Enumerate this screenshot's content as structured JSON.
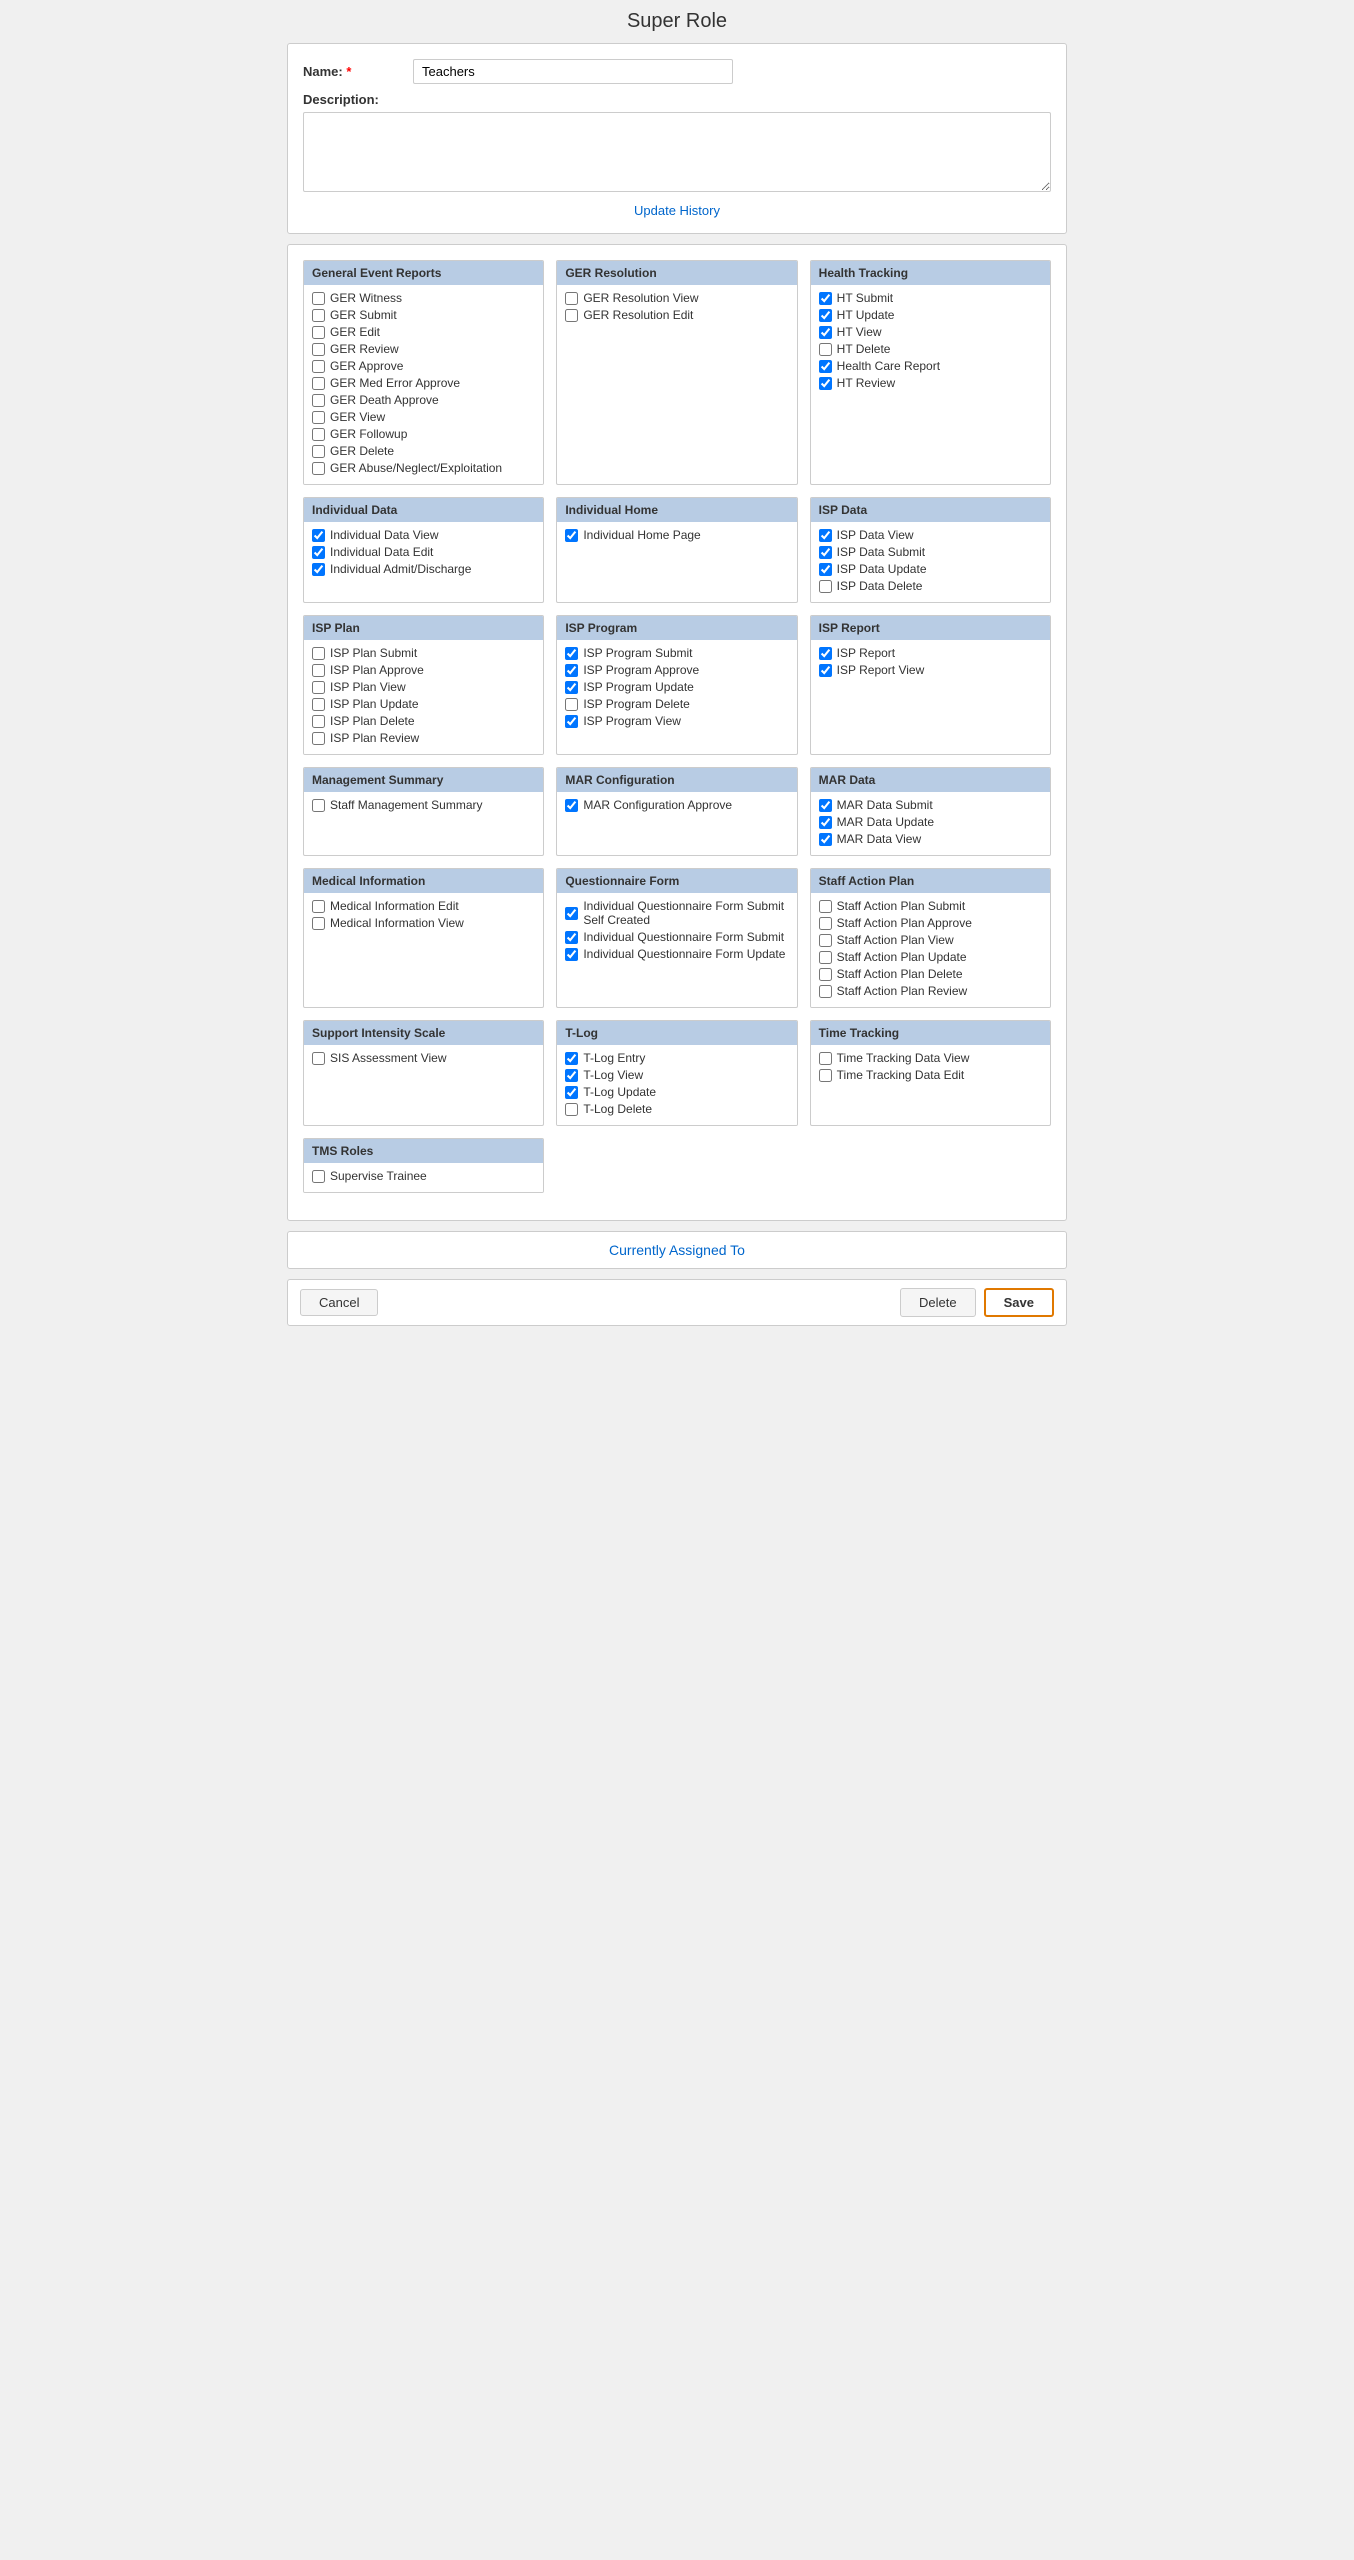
{
  "page": {
    "title": "Super Role"
  },
  "topForm": {
    "nameLabel": "Name:",
    "nameRequired": "*",
    "nameValue": "Teachers",
    "descLabel": "Description:",
    "descPlaceholder": "",
    "updateHistoryLabel": "Update History"
  },
  "permissionSections": [
    {
      "id": "general-event-reports",
      "header": "General Event Reports",
      "items": [
        {
          "label": "GER Witness",
          "checked": false
        },
        {
          "label": "GER Submit",
          "checked": false
        },
        {
          "label": "GER Edit",
          "checked": false
        },
        {
          "label": "GER Review",
          "checked": false
        },
        {
          "label": "GER Approve",
          "checked": false
        },
        {
          "label": "GER Med Error Approve",
          "checked": false
        },
        {
          "label": "GER Death Approve",
          "checked": false
        },
        {
          "label": "GER View",
          "checked": false
        },
        {
          "label": "GER Followup",
          "checked": false
        },
        {
          "label": "GER Delete",
          "checked": false
        },
        {
          "label": "GER Abuse/Neglect/Exploitation",
          "checked": false
        }
      ]
    },
    {
      "id": "ger-resolution",
      "header": "GER Resolution",
      "items": [
        {
          "label": "GER Resolution View",
          "checked": false
        },
        {
          "label": "GER Resolution Edit",
          "checked": false
        }
      ]
    },
    {
      "id": "health-tracking",
      "header": "Health Tracking",
      "items": [
        {
          "label": "HT Submit",
          "checked": true
        },
        {
          "label": "HT Update",
          "checked": true
        },
        {
          "label": "HT View",
          "checked": true
        },
        {
          "label": "HT Delete",
          "checked": false
        },
        {
          "label": "Health Care Report",
          "checked": true
        },
        {
          "label": "HT Review",
          "checked": true
        }
      ]
    },
    {
      "id": "individual-data",
      "header": "Individual Data",
      "items": [
        {
          "label": "Individual Data View",
          "checked": true
        },
        {
          "label": "Individual Data Edit",
          "checked": true
        },
        {
          "label": "Individual Admit/Discharge",
          "checked": true
        }
      ]
    },
    {
      "id": "individual-home",
      "header": "Individual Home",
      "items": [
        {
          "label": "Individual Home Page",
          "checked": true
        }
      ]
    },
    {
      "id": "isp-data",
      "header": "ISP Data",
      "items": [
        {
          "label": "ISP Data View",
          "checked": true
        },
        {
          "label": "ISP Data Submit",
          "checked": true
        },
        {
          "label": "ISP Data Update",
          "checked": true
        },
        {
          "label": "ISP Data Delete",
          "checked": false
        }
      ]
    },
    {
      "id": "isp-plan",
      "header": "ISP Plan",
      "items": [
        {
          "label": "ISP Plan Submit",
          "checked": false
        },
        {
          "label": "ISP Plan Approve",
          "checked": false
        },
        {
          "label": "ISP Plan View",
          "checked": false
        },
        {
          "label": "ISP Plan Update",
          "checked": false
        },
        {
          "label": "ISP Plan Delete",
          "checked": false
        },
        {
          "label": "ISP Plan Review",
          "checked": false
        }
      ]
    },
    {
      "id": "isp-program",
      "header": "ISP Program",
      "items": [
        {
          "label": "ISP Program Submit",
          "checked": true
        },
        {
          "label": "ISP Program Approve",
          "checked": true
        },
        {
          "label": "ISP Program Update",
          "checked": true
        },
        {
          "label": "ISP Program Delete",
          "checked": false
        },
        {
          "label": "ISP Program View",
          "checked": true
        }
      ]
    },
    {
      "id": "isp-report",
      "header": "ISP Report",
      "items": [
        {
          "label": "ISP Report",
          "checked": true
        },
        {
          "label": "ISP Report View",
          "checked": true
        }
      ]
    },
    {
      "id": "management-summary",
      "header": "Management Summary",
      "items": [
        {
          "label": "Staff Management Summary",
          "checked": false
        }
      ]
    },
    {
      "id": "mar-configuration",
      "header": "MAR Configuration",
      "items": [
        {
          "label": "MAR Configuration Approve",
          "checked": true
        }
      ]
    },
    {
      "id": "mar-data",
      "header": "MAR Data",
      "items": [
        {
          "label": "MAR Data Submit",
          "checked": true
        },
        {
          "label": "MAR Data Update",
          "checked": true
        },
        {
          "label": "MAR Data View",
          "checked": true
        }
      ]
    },
    {
      "id": "medical-information",
      "header": "Medical Information",
      "items": [
        {
          "label": "Medical Information Edit",
          "checked": false
        },
        {
          "label": "Medical Information View",
          "checked": false
        }
      ]
    },
    {
      "id": "questionnaire-form",
      "header": "Questionnaire Form",
      "items": [
        {
          "label": "Individual Questionnaire Form Submit Self Created",
          "checked": true
        },
        {
          "label": "Individual Questionnaire Form Submit",
          "checked": true
        },
        {
          "label": "Individual Questionnaire Form Update",
          "checked": true
        }
      ]
    },
    {
      "id": "staff-action-plan",
      "header": "Staff Action Plan",
      "items": [
        {
          "label": "Staff Action Plan Submit",
          "checked": false
        },
        {
          "label": "Staff Action Plan Approve",
          "checked": false
        },
        {
          "label": "Staff Action Plan View",
          "checked": false
        },
        {
          "label": "Staff Action Plan Update",
          "checked": false
        },
        {
          "label": "Staff Action Plan Delete",
          "checked": false
        },
        {
          "label": "Staff Action Plan Review",
          "checked": false
        }
      ]
    },
    {
      "id": "support-intensity-scale",
      "header": "Support Intensity Scale",
      "items": [
        {
          "label": "SIS Assessment View",
          "checked": false
        }
      ]
    },
    {
      "id": "t-log",
      "header": "T-Log",
      "items": [
        {
          "label": "T-Log Entry",
          "checked": true
        },
        {
          "label": "T-Log View",
          "checked": true
        },
        {
          "label": "T-Log Update",
          "checked": true
        },
        {
          "label": "T-Log Delete",
          "checked": false
        }
      ]
    },
    {
      "id": "time-tracking",
      "header": "Time Tracking",
      "items": [
        {
          "label": "Time Tracking Data View",
          "checked": false
        },
        {
          "label": "Time Tracking Data Edit",
          "checked": false
        }
      ]
    },
    {
      "id": "tms-roles",
      "header": "TMS Roles",
      "items": [
        {
          "label": "Supervise Trainee",
          "checked": false
        }
      ]
    }
  ],
  "currentlyAssignedLabel": "Currently Assigned To",
  "buttons": {
    "cancel": "Cancel",
    "delete": "Delete",
    "save": "Save"
  }
}
